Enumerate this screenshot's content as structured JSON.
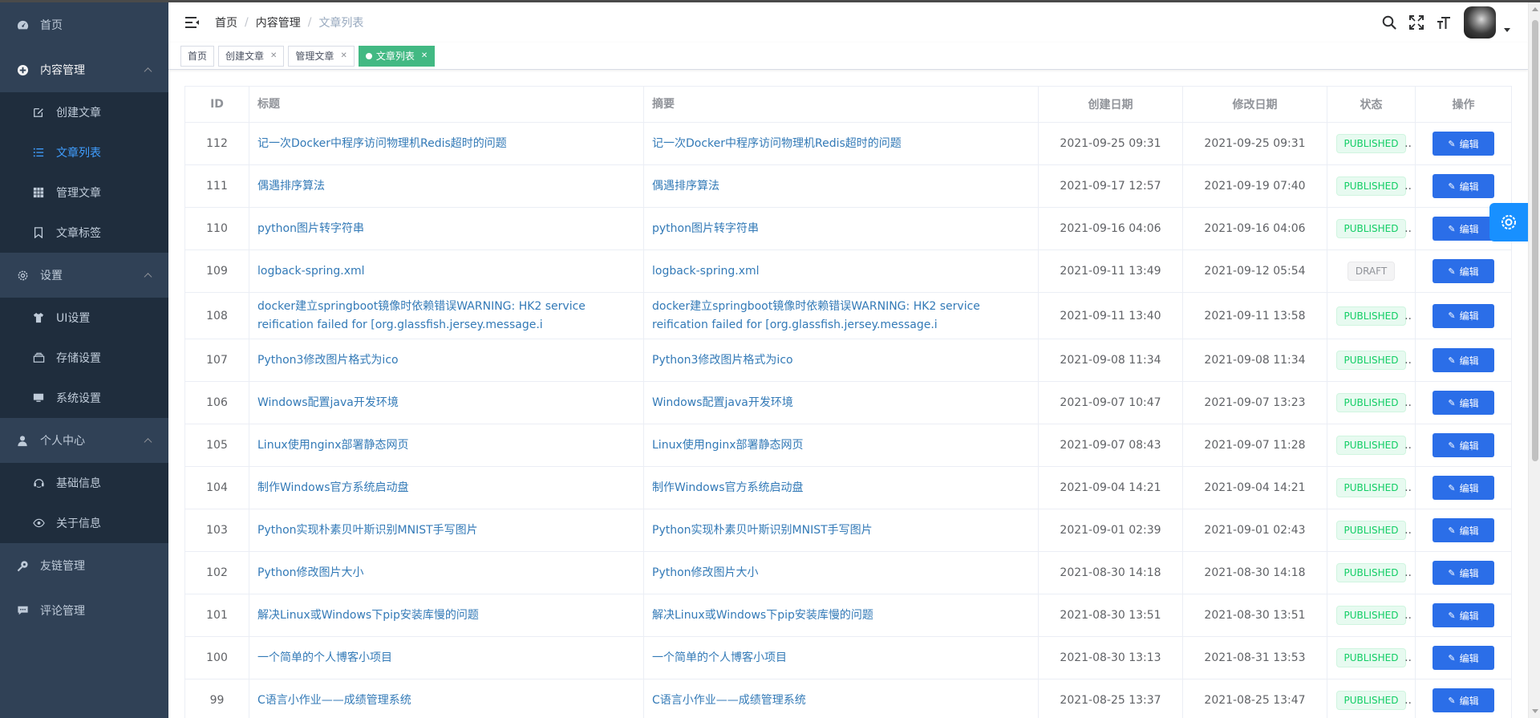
{
  "sidebar": {
    "items": [
      {
        "label": "首页",
        "icon": "dashboard-icon"
      },
      {
        "label": "内容管理",
        "icon": "content-icon"
      },
      {
        "label": "创建文章",
        "icon": "edit-icon"
      },
      {
        "label": "文章列表",
        "icon": "list-icon"
      },
      {
        "label": "管理文章",
        "icon": "table-icon"
      },
      {
        "label": "文章标签",
        "icon": "bookmark-icon"
      },
      {
        "label": "设置",
        "icon": "gear-icon"
      },
      {
        "label": "UI设置",
        "icon": "shirt-icon"
      },
      {
        "label": "存储设置",
        "icon": "storage-icon"
      },
      {
        "label": "系统设置",
        "icon": "monitor-icon"
      },
      {
        "label": "个人中心",
        "icon": "user-icon"
      },
      {
        "label": "基础信息",
        "icon": "profile-icon"
      },
      {
        "label": "关于信息",
        "icon": "eye-icon"
      },
      {
        "label": "友链管理",
        "icon": "link-icon"
      },
      {
        "label": "评论管理",
        "icon": "comment-icon"
      }
    ]
  },
  "breadcrumb": [
    "首页",
    "内容管理",
    "文章列表"
  ],
  "tags": [
    {
      "label": "首页"
    },
    {
      "label": "创建文章"
    },
    {
      "label": "管理文章"
    },
    {
      "label": "文章列表"
    }
  ],
  "colors": {
    "sidebar_bg": "#304156",
    "active": "#409eff",
    "tag_active": "#42b983",
    "primary_button": "#2b6ee8",
    "published": "#13ce66"
  },
  "table": {
    "headers": [
      "ID",
      "标题",
      "摘要",
      "创建日期",
      "修改日期",
      "状态",
      "操作"
    ],
    "edit_label": "编辑",
    "rows": [
      {
        "id": "112",
        "title": "记一次Docker中程序访问物理机Redis超时的问题",
        "summary": "记一次Docker中程序访问物理机Redis超时的问题",
        "created": "2021-09-25 09:31",
        "modified": "2021-09-25 09:31",
        "status": "PUBLISHED"
      },
      {
        "id": "111",
        "title": "偶遇排序算法",
        "summary": "偶遇排序算法",
        "created": "2021-09-17 12:57",
        "modified": "2021-09-19 07:40",
        "status": "PUBLISHED"
      },
      {
        "id": "110",
        "title": "python图片转字符串",
        "summary": "python图片转字符串",
        "created": "2021-09-16 04:06",
        "modified": "2021-09-16 04:06",
        "status": "PUBLISHED"
      },
      {
        "id": "109",
        "title": "logback-spring.xml",
        "summary": "logback-spring.xml",
        "created": "2021-09-11 13:49",
        "modified": "2021-09-12 05:54",
        "status": "DRAFT"
      },
      {
        "id": "108",
        "title": "docker建立springboot镜像时依赖错误WARNING: HK2 service reification failed for [org.glassfish.jersey.message.i",
        "summary": "docker建立springboot镜像时依赖错误WARNING: HK2 service reification failed for [org.glassfish.jersey.message.i",
        "created": "2021-09-11 13:40",
        "modified": "2021-09-11 13:58",
        "status": "PUBLISHED"
      },
      {
        "id": "107",
        "title": "Python3修改图片格式为ico",
        "summary": "Python3修改图片格式为ico",
        "created": "2021-09-08 11:34",
        "modified": "2021-09-08 11:34",
        "status": "PUBLISHED"
      },
      {
        "id": "106",
        "title": "Windows配置java开发环境",
        "summary": "Windows配置java开发环境",
        "created": "2021-09-07 10:47",
        "modified": "2021-09-07 13:23",
        "status": "PUBLISHED"
      },
      {
        "id": "105",
        "title": "Linux使用nginx部署静态网页",
        "summary": "Linux使用nginx部署静态网页",
        "created": "2021-09-07 08:43",
        "modified": "2021-09-07 11:28",
        "status": "PUBLISHED"
      },
      {
        "id": "104",
        "title": "制作Windows官方系统启动盘",
        "summary": "制作Windows官方系统启动盘",
        "created": "2021-09-04 14:21",
        "modified": "2021-09-04 14:21",
        "status": "PUBLISHED"
      },
      {
        "id": "103",
        "title": "Python实现朴素贝叶斯识别MNIST手写图片",
        "summary": "Python实现朴素贝叶斯识别MNIST手写图片",
        "created": "2021-09-01 02:39",
        "modified": "2021-09-01 02:43",
        "status": "PUBLISHED"
      },
      {
        "id": "102",
        "title": "Python修改图片大小",
        "summary": "Python修改图片大小",
        "created": "2021-08-30 14:18",
        "modified": "2021-08-30 14:18",
        "status": "PUBLISHED"
      },
      {
        "id": "101",
        "title": "解决Linux或Windows下pip安装库慢的问题",
        "summary": "解决Linux或Windows下pip安装库慢的问题",
        "created": "2021-08-30 13:51",
        "modified": "2021-08-30 13:51",
        "status": "PUBLISHED"
      },
      {
        "id": "100",
        "title": "一个简单的个人博客小项目",
        "summary": "一个简单的个人博客小项目",
        "created": "2021-08-30 13:13",
        "modified": "2021-08-31 13:53",
        "status": "PUBLISHED"
      },
      {
        "id": "99",
        "title": "C语言小作业——成绩管理系统",
        "summary": "C语言小作业——成绩管理系统",
        "created": "2021-08-25 13:37",
        "modified": "2021-08-25 13:47",
        "status": "PUBLISHED"
      }
    ]
  }
}
